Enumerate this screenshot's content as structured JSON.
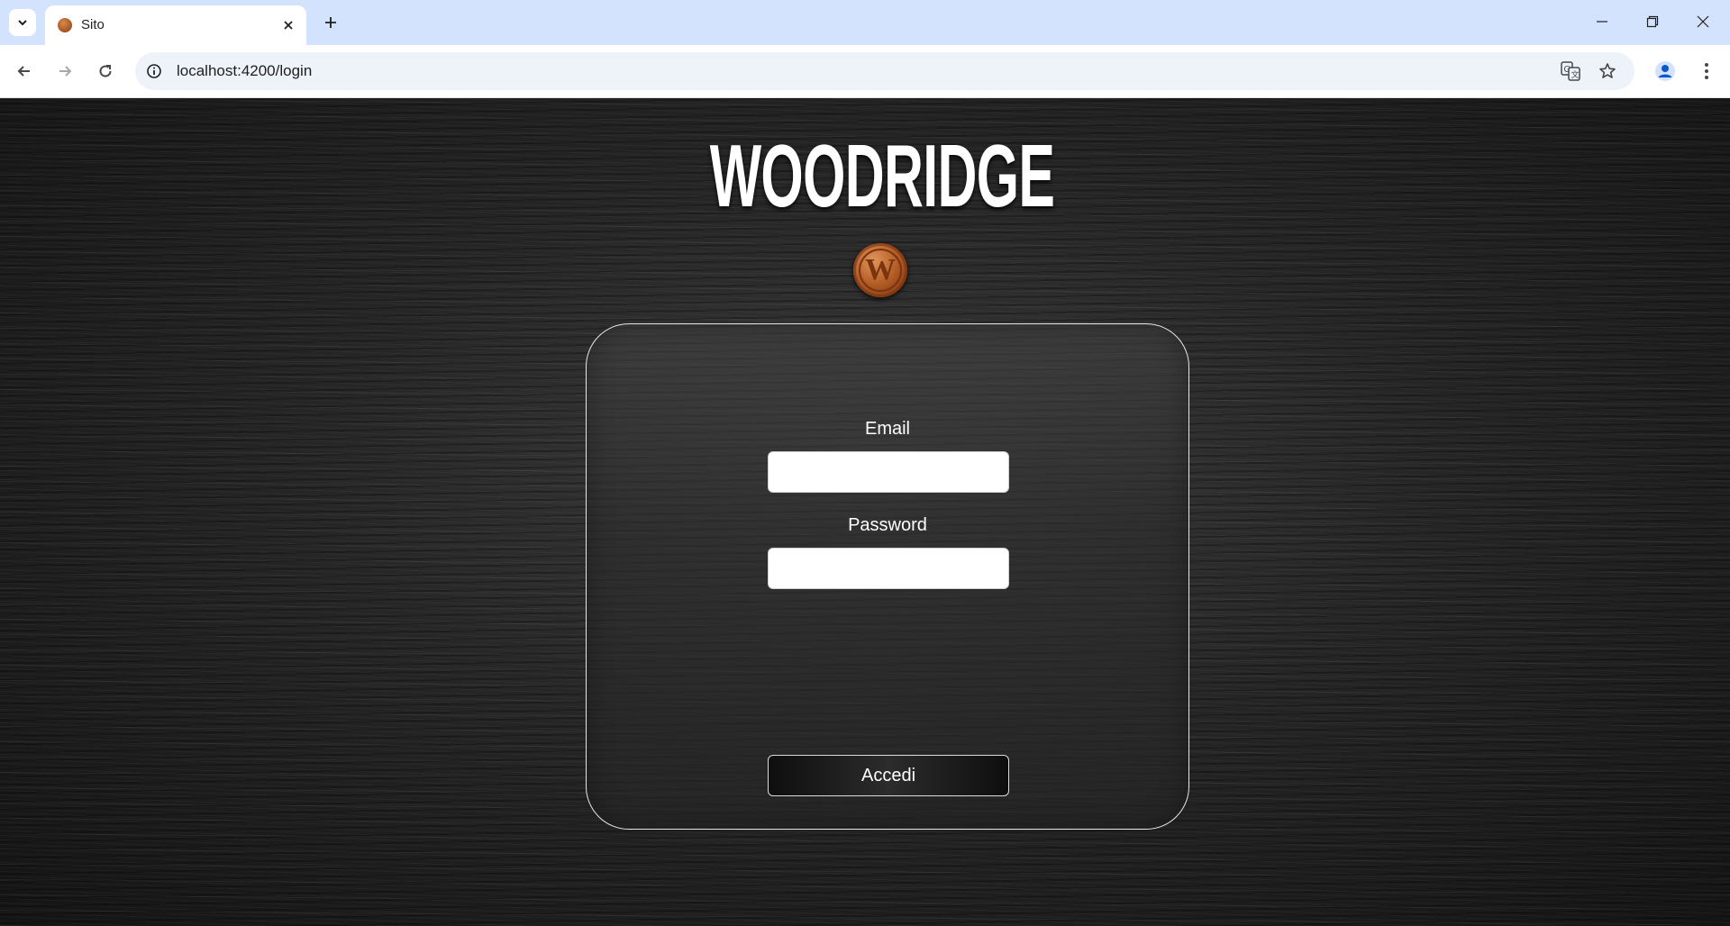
{
  "browser": {
    "tab": {
      "title": "Sito",
      "favicon": "woodridge-favicon"
    },
    "url": "localhost:4200/login",
    "icons": {
      "tab_search": "chevron-down-icon",
      "tab_close": "close-icon",
      "new_tab": "plus-icon",
      "back": "arrow-left-icon",
      "forward": "arrow-right-icon",
      "reload": "reload-icon",
      "site_info": "info-icon",
      "translate": "translate-icon",
      "bookmark": "star-icon",
      "profile": "person-icon",
      "menu": "kebab-menu-icon",
      "minimize": "minimize-icon",
      "restore": "restore-icon",
      "close_window": "close-icon"
    },
    "colors": {
      "tabstrip": "#d3e3fd",
      "omnibox": "#eef2f9",
      "profile_accent": "#0b57d0"
    }
  },
  "page": {
    "brand": {
      "title": "WOODRIDGE",
      "logo_icon": "wordpress-w-logo"
    },
    "login": {
      "email_label": "Email",
      "email_value": "",
      "password_label": "Password",
      "password_value": "",
      "submit_label": "Accedi"
    }
  }
}
